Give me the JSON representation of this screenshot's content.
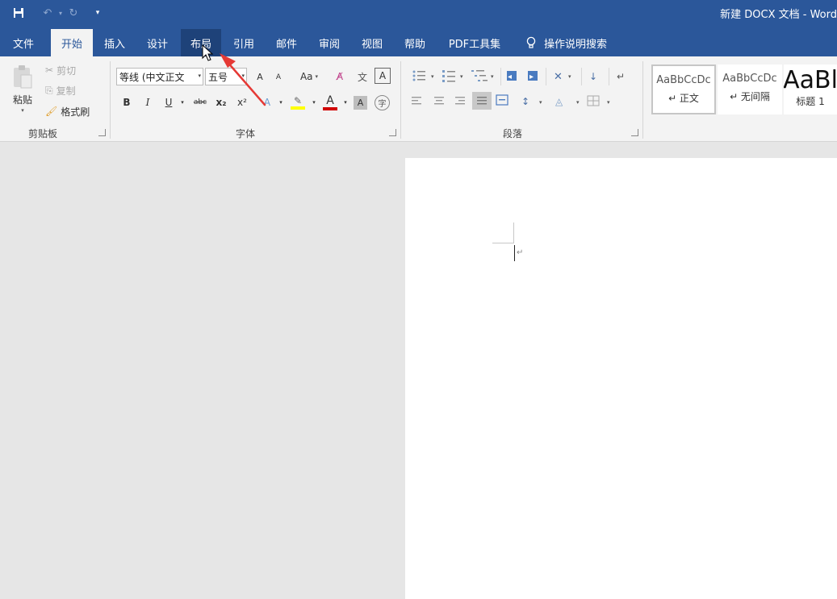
{
  "title_bar": {
    "document_title": "新建 DOCX 文档  -  Word",
    "quick_access": [
      "save-icon",
      "undo-icon",
      "redo-icon",
      "customize-icon"
    ]
  },
  "tabs": [
    {
      "label": "文件"
    },
    {
      "label": "开始"
    },
    {
      "label": "插入"
    },
    {
      "label": "设计"
    },
    {
      "label": "布局"
    },
    {
      "label": "引用"
    },
    {
      "label": "邮件"
    },
    {
      "label": "审阅"
    },
    {
      "label": "视图"
    },
    {
      "label": "帮助"
    },
    {
      "label": "PDF工具集"
    }
  ],
  "tell_me": {
    "label": "操作说明搜索",
    "icon": "lightbulb-icon"
  },
  "ribbon": {
    "clipboard": {
      "group_label": "剪贴板",
      "paste": "粘贴",
      "cut": "剪切",
      "copy": "复制",
      "format_painter": "格式刷"
    },
    "font": {
      "group_label": "字体",
      "font_name": "等线 (中文正文",
      "font_size": "五号",
      "grow": "A",
      "shrink": "A",
      "change_case": "Aa",
      "bold": "B",
      "italic": "I",
      "underline": "U",
      "strikethrough": "abc",
      "subscript": "x₂",
      "superscript": "x²",
      "font_color": "A",
      "char_shading": "A",
      "phonetic": "文",
      "char_border": "A",
      "enclose": "字"
    },
    "paragraph": {
      "group_label": "段落"
    },
    "styles": {
      "items": [
        {
          "sample": "AaBbCcDc",
          "name": "↵ 正文"
        },
        {
          "sample": "AaBbCcDc",
          "name": "↵ 无间隔"
        },
        {
          "sample": "AaBl",
          "name": "标题 1"
        }
      ]
    }
  },
  "document": {
    "paragraph_mark": "↵"
  },
  "colors": {
    "title_bar": "#2b579a",
    "ribbon": "#f3f3f3",
    "annotation_arrow": "#e53935",
    "font_color_bar": "#d00000",
    "highlight_bar": "#ffff00"
  }
}
